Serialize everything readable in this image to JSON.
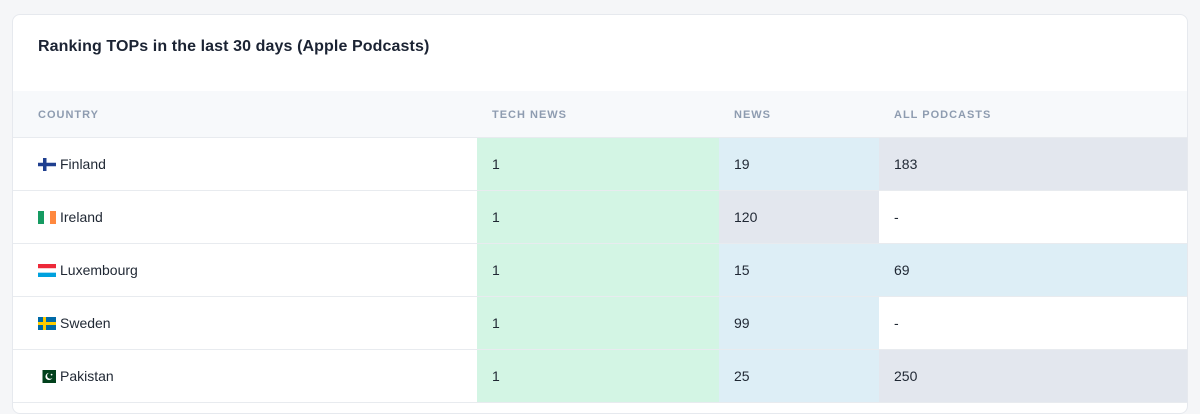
{
  "title": "Ranking TOPs in the last 30 days (Apple Podcasts)",
  "columns": [
    "COUNTRY",
    "TECH NEWS",
    "NEWS",
    "ALL PODCASTS"
  ],
  "colors": {
    "green": "#d3f5e4",
    "blue": "#ddeef6",
    "gray": "#e3e7ee"
  },
  "rows": [
    {
      "country": "Finland",
      "flag": "finland-flag-icon",
      "tech": "1",
      "news": "19",
      "all": "183"
    },
    {
      "country": "Ireland",
      "flag": "ireland-flag-icon",
      "tech": "1",
      "news": "120",
      "all": "-"
    },
    {
      "country": "Luxembourg",
      "flag": "luxembourg-flag-icon",
      "tech": "1",
      "news": "15",
      "all": "69"
    },
    {
      "country": "Sweden",
      "flag": "sweden-flag-icon",
      "tech": "1",
      "news": "99",
      "all": "-"
    },
    {
      "country": "Pakistan",
      "flag": "pakistan-flag-icon",
      "tech": "1",
      "news": "25",
      "all": "250"
    }
  ]
}
